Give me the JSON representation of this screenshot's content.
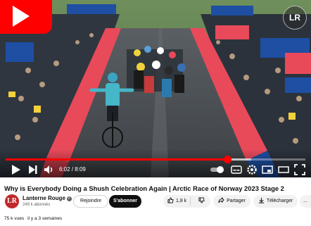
{
  "player": {
    "channel_watermark": "LR",
    "time": {
      "current": "6:02",
      "duration": "8:09"
    },
    "progress_fraction": 0.74,
    "buffered_fraction": 0.82
  },
  "video": {
    "title": "Why is Everybody Doing a Shush Celebration Again | Arctic Race of Norway 2023 Stage 2"
  },
  "channel": {
    "name": "Lanterne Rouge",
    "subscribers": "249 k abonnés",
    "avatar_letters": "LR"
  },
  "actions": {
    "join_label": "Rejoindre",
    "subscribe_label": "S'abonner",
    "like_count": "1,8 k",
    "share_label": "Partager",
    "download_label": "Télécharger",
    "more_label": "..."
  },
  "description": {
    "views": "75 k vues",
    "age": "il y a 3 semaines"
  },
  "colors": {
    "youtube_red": "#ff0000",
    "accent_dark": "#0f0f0f",
    "banner_red": "#e84a5a",
    "sponsor_blue": "#1e4fa3"
  },
  "icons": [
    "youtube-play-icon",
    "play-icon",
    "next-icon",
    "volume-icon",
    "autoplay-toggle-icon",
    "subtitles-icon",
    "settings-icon",
    "miniplayer-icon",
    "theater-icon",
    "fullscreen-icon",
    "like-icon",
    "dislike-icon",
    "share-icon",
    "download-icon",
    "verified-icon"
  ]
}
